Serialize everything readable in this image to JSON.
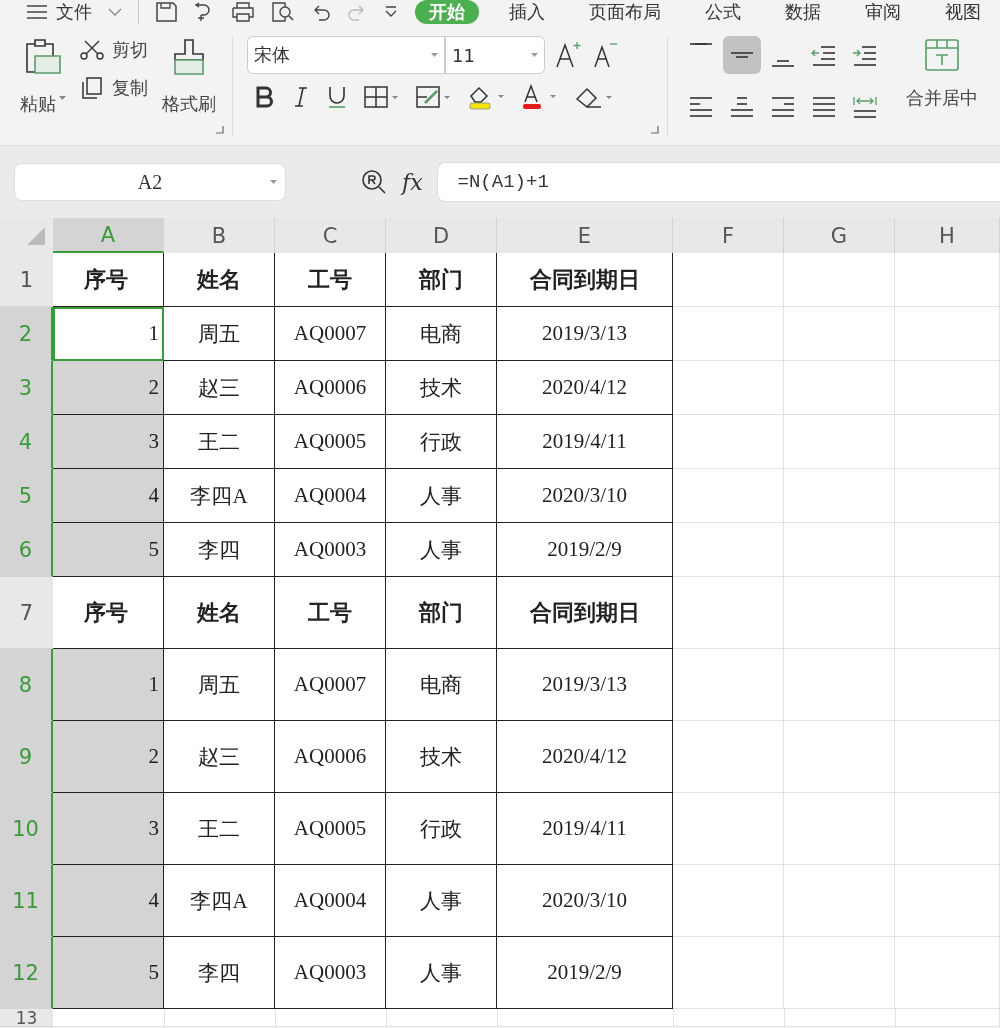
{
  "menu": {
    "file": "文件",
    "tabs": [
      {
        "label": "开始",
        "selected": true
      },
      {
        "label": "插入",
        "selected": false
      },
      {
        "label": "页面布局",
        "selected": false
      },
      {
        "label": "公式",
        "selected": false
      },
      {
        "label": "数据",
        "selected": false
      },
      {
        "label": "审阅",
        "selected": false
      },
      {
        "label": "视图",
        "selected": false
      }
    ]
  },
  "ribbon": {
    "paste": "粘贴",
    "cut": "剪切",
    "copy": "复制",
    "format_painter": "格式刷",
    "font": "宋体",
    "font_size": "11",
    "merge": "合并居中",
    "align_buttons": [
      {
        "kind": "top",
        "selected": false
      },
      {
        "kind": "middle",
        "selected": true
      },
      {
        "kind": "bottom",
        "selected": false
      },
      {
        "kind": "outdent",
        "selected": false
      },
      {
        "kind": "indent",
        "selected": false
      },
      {
        "kind": "left",
        "selected": false
      },
      {
        "kind": "center",
        "selected": false
      },
      {
        "kind": "right",
        "selected": false
      },
      {
        "kind": "justify",
        "selected": false
      },
      {
        "kind": "distributed",
        "selected": false
      }
    ]
  },
  "formula_bar": {
    "name_box": "A2",
    "fx": "fx",
    "formula": "=N(A1)+1"
  },
  "columns": [
    {
      "label": "A",
      "selected": true
    },
    {
      "label": "B",
      "selected": false
    },
    {
      "label": "C",
      "selected": false
    },
    {
      "label": "D",
      "selected": false
    },
    {
      "label": "E",
      "selected": false
    },
    {
      "label": "F",
      "selected": false
    },
    {
      "label": "G",
      "selected": false
    },
    {
      "label": "H",
      "selected": false
    }
  ],
  "rows": [
    {
      "number": "1",
      "kind": "header",
      "selected": false,
      "active": false,
      "cells": [
        "序号",
        "姓名",
        "工号",
        "部门",
        "合同到期日"
      ]
    },
    {
      "number": "2",
      "kind": "data",
      "selected": true,
      "active": true,
      "cells": [
        "1",
        "周五",
        "AQ0007",
        "电商",
        "2019/3/13"
      ]
    },
    {
      "number": "3",
      "kind": "data",
      "selected": true,
      "active": false,
      "cells": [
        "2",
        "赵三",
        "AQ0006",
        "技术",
        "2020/4/12"
      ]
    },
    {
      "number": "4",
      "kind": "data",
      "selected": true,
      "active": false,
      "cells": [
        "3",
        "王二",
        "AQ0005",
        "行政",
        "2019/4/11"
      ]
    },
    {
      "number": "5",
      "kind": "data",
      "selected": true,
      "active": false,
      "cells": [
        "4",
        "李四A",
        "AQ0004",
        "人事",
        "2020/3/10"
      ]
    },
    {
      "number": "6",
      "kind": "data",
      "selected": true,
      "active": false,
      "cells": [
        "5",
        "李四",
        "AQ0003",
        "人事",
        "2019/2/9"
      ]
    },
    {
      "number": "7",
      "kind": "header",
      "selected": false,
      "active": false,
      "cells": [
        "序号",
        "姓名",
        "工号",
        "部门",
        "合同到期日"
      ]
    },
    {
      "number": "8",
      "kind": "data",
      "selected": true,
      "active": false,
      "cells": [
        "1",
        "周五",
        "AQ0007",
        "电商",
        "2019/3/13"
      ]
    },
    {
      "number": "9",
      "kind": "data",
      "selected": true,
      "active": false,
      "cells": [
        "2",
        "赵三",
        "AQ0006",
        "技术",
        "2020/4/12"
      ]
    },
    {
      "number": "10",
      "kind": "data",
      "selected": true,
      "active": false,
      "cells": [
        "3",
        "王二",
        "AQ0005",
        "行政",
        "2019/4/11"
      ]
    },
    {
      "number": "11",
      "kind": "data",
      "selected": true,
      "active": false,
      "cells": [
        "4",
        "李四A",
        "AQ0004",
        "人事",
        "2020/3/10"
      ]
    },
    {
      "number": "12",
      "kind": "data",
      "selected": true,
      "active": false,
      "cells": [
        "5",
        "李四",
        "AQ0003",
        "人事",
        "2019/2/9"
      ]
    },
    {
      "number": "13",
      "kind": "empty",
      "selected": false,
      "active": false,
      "cells": []
    }
  ]
}
